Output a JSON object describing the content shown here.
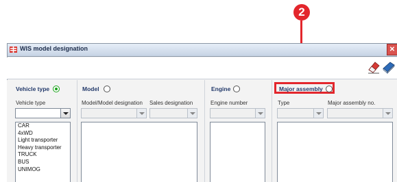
{
  "callout": {
    "number": "2"
  },
  "window": {
    "title": "WIS model designation",
    "close_label": "✕"
  },
  "toolbar": {
    "eraser_icon": "eraser-icon",
    "book_icon": "book-icon"
  },
  "sections": {
    "vehicle_type": {
      "title": "Vehicle type",
      "selected": true,
      "field_label": "Vehicle type",
      "combo_value": "",
      "items": [
        "CAR",
        "4xWD",
        "Light transporter",
        "Heavy transporter",
        "TRUCK",
        "BUS",
        "UNIMOG"
      ]
    },
    "model": {
      "title": "Model",
      "selected": false,
      "field1_label": "Model/Model designation",
      "field2_label": "Sales designation"
    },
    "engine": {
      "title": "Engine",
      "selected": false,
      "field_label": "Engine number"
    },
    "major_assembly": {
      "title": "Major assembly",
      "selected": false,
      "field1_label": "Type",
      "field2_label": "Major assembly no."
    }
  },
  "colors": {
    "callout": "#e3262c",
    "section_title": "#233a6b",
    "radio_on": "#1aa31a"
  }
}
